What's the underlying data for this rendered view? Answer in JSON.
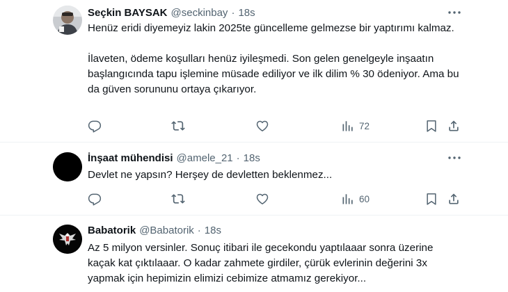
{
  "tweets": [
    {
      "name": "Seçkin BAYSAK",
      "handle": "@seckinbay",
      "separator": "·",
      "time": "18s",
      "avatar_icon": "profile-photo-person",
      "paragraphs": [
        "Henüz eridi diyemeyiz lakin 2025te güncelleme gelmezse bir yaptırımı kalmaz.",
        "İlaveten, ödeme koşulları henüz iyileşmedi. Son gelen genelgeyle inşaatın başlangıcında tapu işlemine müsade ediliyor ve ilk dilim % 30 ödeniyor. Ama bu da güven sorununu ortaya çıkarıyor."
      ],
      "views": "72"
    },
    {
      "name": "İnşaat mühendisi",
      "handle": "@amele_21",
      "separator": "·",
      "time": "18s",
      "avatar_icon": "black-circle-avatar",
      "paragraphs": [
        "Devlet ne yapsın? Herşey de devletten beklenmez..."
      ],
      "views": "60"
    },
    {
      "name": "Babatorik",
      "handle": "@Babatorik",
      "separator": "·",
      "time": "18s",
      "avatar_icon": "eagle-emblem-avatar",
      "paragraphs": [
        "Az 5 milyon versinler. Sonuç itibari ile gecekondu yaptılaaar sonra üzerine kaçak kat çıktılaaar. O kadar zahmete girdiler, çürük evlerinin değerini 3x yapmak için hepimizin elimizi cebimize atmamız gerekiyor..."
      ]
    }
  ],
  "colors": {
    "text": "#0f1419",
    "secondary": "#536471",
    "divider": "#eff3f4"
  },
  "icons": {
    "reply": "reply-icon",
    "retweet": "retweet-icon",
    "like": "heart-icon",
    "views": "views-chart-icon",
    "bookmark": "bookmark-icon",
    "share": "share-icon",
    "more": "more-dots-icon"
  }
}
